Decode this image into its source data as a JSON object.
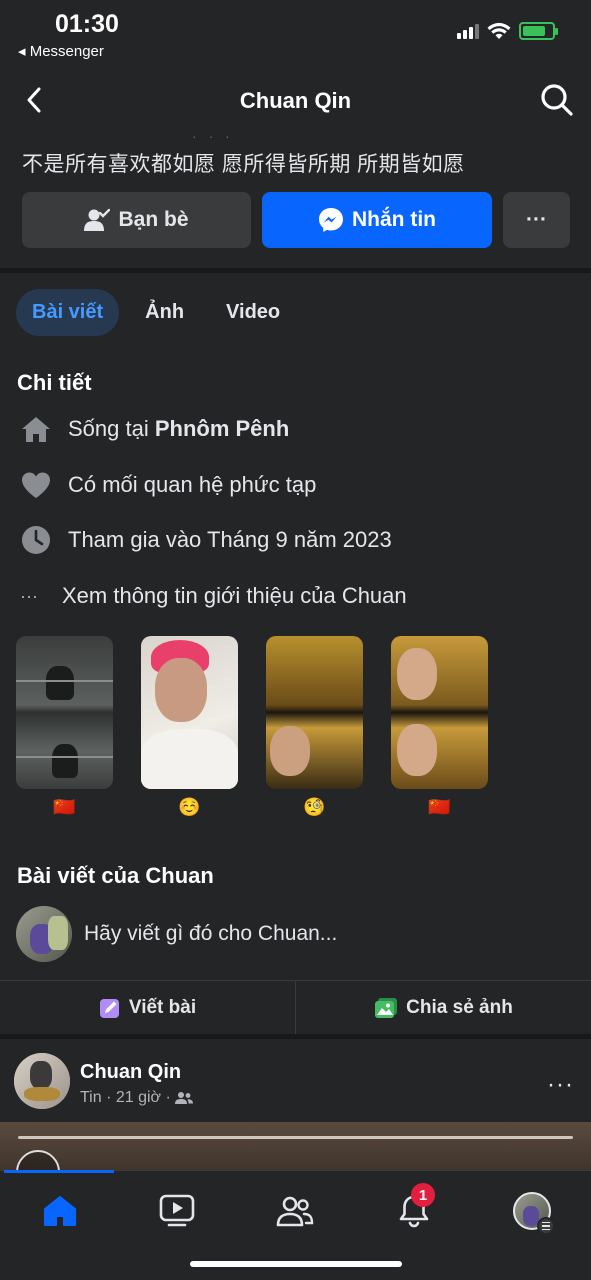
{
  "status_bar": {
    "time": "01:30",
    "back_app": "◂ Messenger"
  },
  "nav": {
    "title": "Chuan Qin",
    "back_icon": "chevron-left-icon",
    "search_icon": "search-icon"
  },
  "profile": {
    "bio": "不是所有喜欢都如愿  愿所得皆所期  所期皆如愿",
    "bio_ghost": "·  · ·",
    "friends_label": "Bạn bè",
    "message_label": "Nhắn tin",
    "more_label": "···"
  },
  "tabs": [
    {
      "label": "Bài viết",
      "active": true
    },
    {
      "label": "Ảnh",
      "active": false
    },
    {
      "label": "Video",
      "active": false
    }
  ],
  "details": {
    "title": "Chi tiết",
    "lives_prefix": "Sống tại ",
    "lives_city": "Phnôm Pênh",
    "relationship": "Có mối quan hệ phức tạp",
    "joined": "Tham gia vào Tháng 9 năm 2023",
    "see_about": "Xem thông tin giới thiệu của Chuan",
    "see_about_icon": "···"
  },
  "stories": [
    {
      "emoji": "🇨🇳"
    },
    {
      "emoji": "☺️"
    },
    {
      "emoji": "🧐"
    },
    {
      "emoji": "🇨🇳"
    }
  ],
  "posts_section": {
    "title": "Bài viết của Chuan",
    "composer_placeholder": "Hãy viết gì đó cho Chuan...",
    "write_post": "Viết bài",
    "share_photo": "Chia sẻ ảnh"
  },
  "post": {
    "author": "Chuan Qin",
    "meta": "Tin · 21 giờ ·",
    "more": "···"
  },
  "bottom_nav": {
    "notifications_badge": "1"
  },
  "colors": {
    "background": "#242526",
    "accent": "#0866ff",
    "active_tab_bg": "#263951",
    "active_tab_text": "#4599ff",
    "badge": "#e41e3f"
  }
}
